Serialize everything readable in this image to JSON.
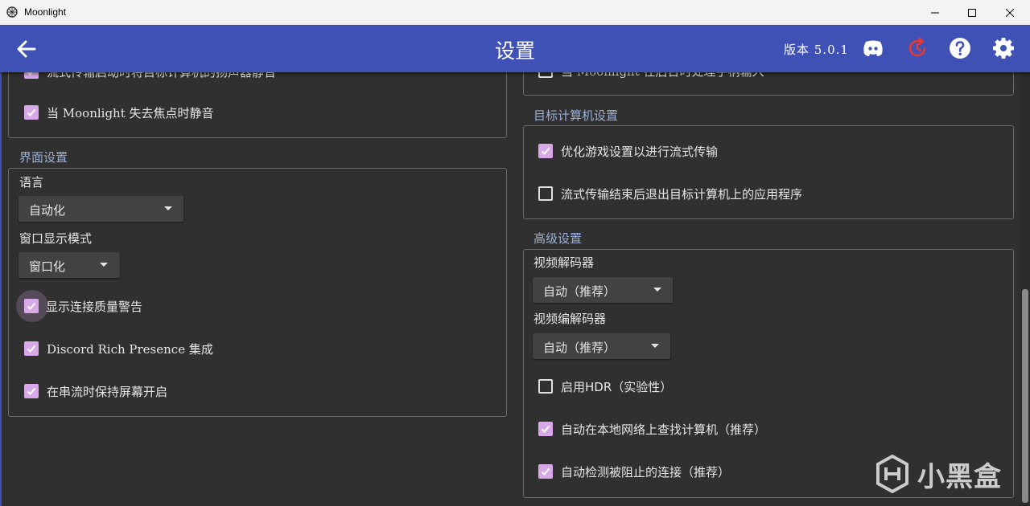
{
  "window": {
    "title": "Moonlight"
  },
  "appbar": {
    "title": "设置",
    "version": "版本 5.0.1"
  },
  "left": {
    "top_partial": {
      "text": "流式传输启动时将目标计算机的扬声器静音"
    },
    "mute_on_focus_loss": {
      "label": "当 Moonlight 失去焦点时静音",
      "checked": true
    },
    "ui_settings": {
      "title": "界面设置",
      "language": {
        "label": "语言",
        "value": "自动化"
      },
      "window_mode": {
        "label": "窗口显示模式",
        "value": "窗口化"
      },
      "checks": [
        {
          "label": "显示连接质量警告",
          "checked": true
        },
        {
          "label": "Discord Rich Presence 集成",
          "checked": true
        },
        {
          "label": "在串流时保持屏幕开启",
          "checked": true
        }
      ]
    }
  },
  "right": {
    "top_partial": {
      "text": "当 Moonlight 在后台时处理手柄输入"
    },
    "host_settings": {
      "title": "目标计算机设置",
      "checks": [
        {
          "label": "优化游戏设置以进行流式传输",
          "checked": true
        },
        {
          "label": "流式传输结束后退出目标计算机上的应用程序",
          "checked": false
        }
      ]
    },
    "advanced": {
      "title": "高级设置",
      "decoder": {
        "label": "视频解码器",
        "value": "自动（推荐）"
      },
      "codec": {
        "label": "视频编解码器",
        "value": "自动（推荐）"
      },
      "checks": [
        {
          "label": "启用HDR（实验性）",
          "checked": false
        },
        {
          "label": "自动在本地网络上查找计算机（推荐）",
          "checked": true
        },
        {
          "label": "自动检测被阻止的连接（推荐）",
          "checked": true
        }
      ]
    }
  },
  "watermark": {
    "text": "小黑盒"
  },
  "colors": {
    "appbar": "#3f51b5",
    "background": "#303030",
    "accent": "#d9a8e8",
    "group_title": "#9ab0d8",
    "update_icon": "#e53935"
  }
}
